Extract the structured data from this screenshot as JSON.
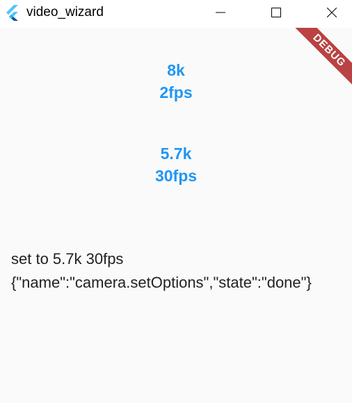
{
  "window": {
    "title": "video_wizard",
    "controls": {
      "minimize_icon": "minimize-icon",
      "maximize_icon": "maximize-icon",
      "close_icon": "close-icon"
    }
  },
  "banner": {
    "label": "DEBUG",
    "color": "#b02828"
  },
  "options": [
    {
      "resolution": "8k",
      "fps": "2fps"
    },
    {
      "resolution": "5.7k",
      "fps": "30fps"
    }
  ],
  "status": {
    "message": "set to 5.7k 30fps",
    "response": "{\"name\":\"camera.setOptions\",\"state\":\"done\"}"
  },
  "colors": {
    "accent": "#2196f3",
    "background": "#fafafa",
    "titlebar": "#ffffff"
  }
}
